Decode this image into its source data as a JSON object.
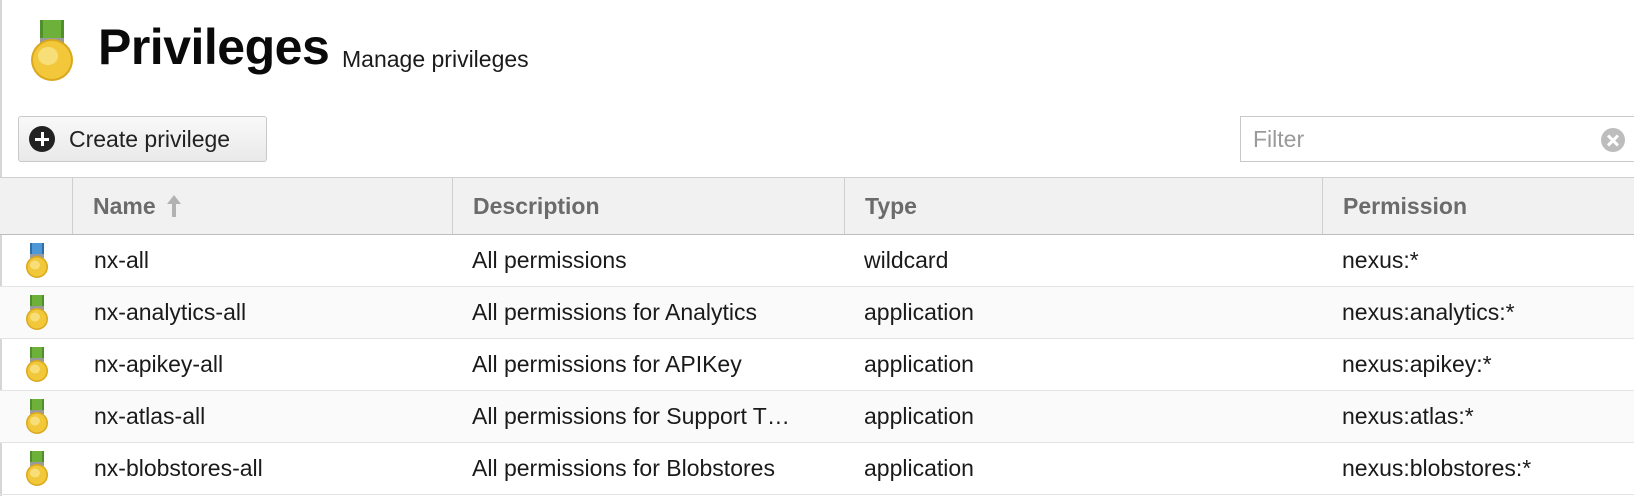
{
  "header": {
    "title": "Privileges",
    "subtitle": "Manage privileges",
    "icon": "privilege-medal-icon"
  },
  "toolbar": {
    "create_label": "Create privilege",
    "filter_placeholder": "Filter"
  },
  "table": {
    "columns": [
      "Name",
      "Description",
      "Type",
      "Permission"
    ],
    "sort": {
      "column": "Name",
      "direction": "ascending"
    },
    "rows": [
      {
        "icon": "blue-ribbon-medal-icon",
        "name": "nx-all",
        "description": "All permissions",
        "type": "wildcard",
        "permission": "nexus:*"
      },
      {
        "icon": "green-ribbon-medal-icon",
        "name": "nx-analytics-all",
        "description": "All permissions for Analytics",
        "type": "application",
        "permission": "nexus:analytics:*"
      },
      {
        "icon": "green-ribbon-medal-icon",
        "name": "nx-apikey-all",
        "description": "All permissions for APIKey",
        "type": "application",
        "permission": "nexus:apikey:*"
      },
      {
        "icon": "green-ribbon-medal-icon",
        "name": "nx-atlas-all",
        "description": "All permissions for Support T…",
        "type": "application",
        "permission": "nexus:atlas:*"
      },
      {
        "icon": "green-ribbon-medal-icon",
        "name": "nx-blobstores-all",
        "description": "All permissions for Blobstores",
        "type": "application",
        "permission": "nexus:blobstores:*"
      }
    ]
  },
  "colors": {
    "medal_gold": "#f2c83a",
    "ribbon_green": "#5fa236",
    "ribbon_blue": "#3d87c9",
    "header_text": "#6b6b6b"
  }
}
